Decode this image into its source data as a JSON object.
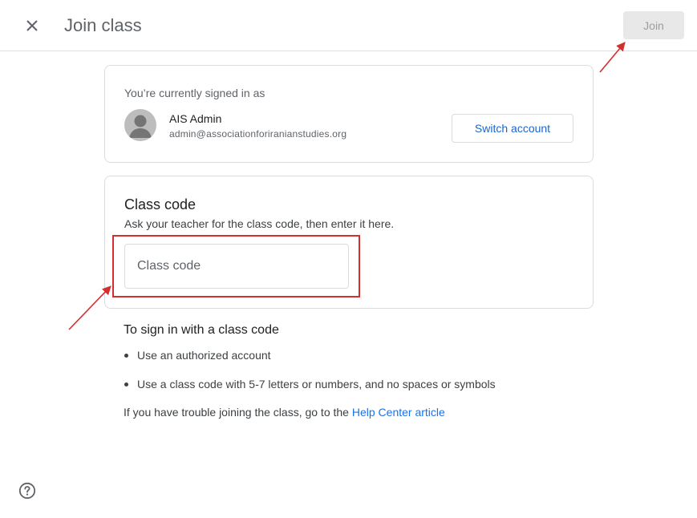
{
  "header": {
    "title": "Join class",
    "join_label": "Join"
  },
  "account": {
    "signed_in_label": "You’re currently signed in as",
    "name": "AIS Admin",
    "email": "admin@associationforiranianstudies.org",
    "switch_label": "Switch account"
  },
  "class_code": {
    "heading": "Class code",
    "description": "Ask your teacher for the class code, then enter it here.",
    "input_placeholder": "Class code",
    "input_value": ""
  },
  "instructions": {
    "heading": "To sign in with a class code",
    "items": [
      "Use an authorized account",
      "Use a class code with 5-7 letters or numbers, and no spaces or symbols"
    ],
    "help_text": "If you have trouble joining the class, go to the",
    "help_link": "Help Center article"
  },
  "icons": {
    "close": "close-icon",
    "avatar": "avatar-person-icon",
    "help": "help-circle-icon"
  },
  "colors": {
    "accent": "#1a73e8",
    "annotation": "#d32f2f",
    "disabled_button": "#e8e8e8"
  }
}
